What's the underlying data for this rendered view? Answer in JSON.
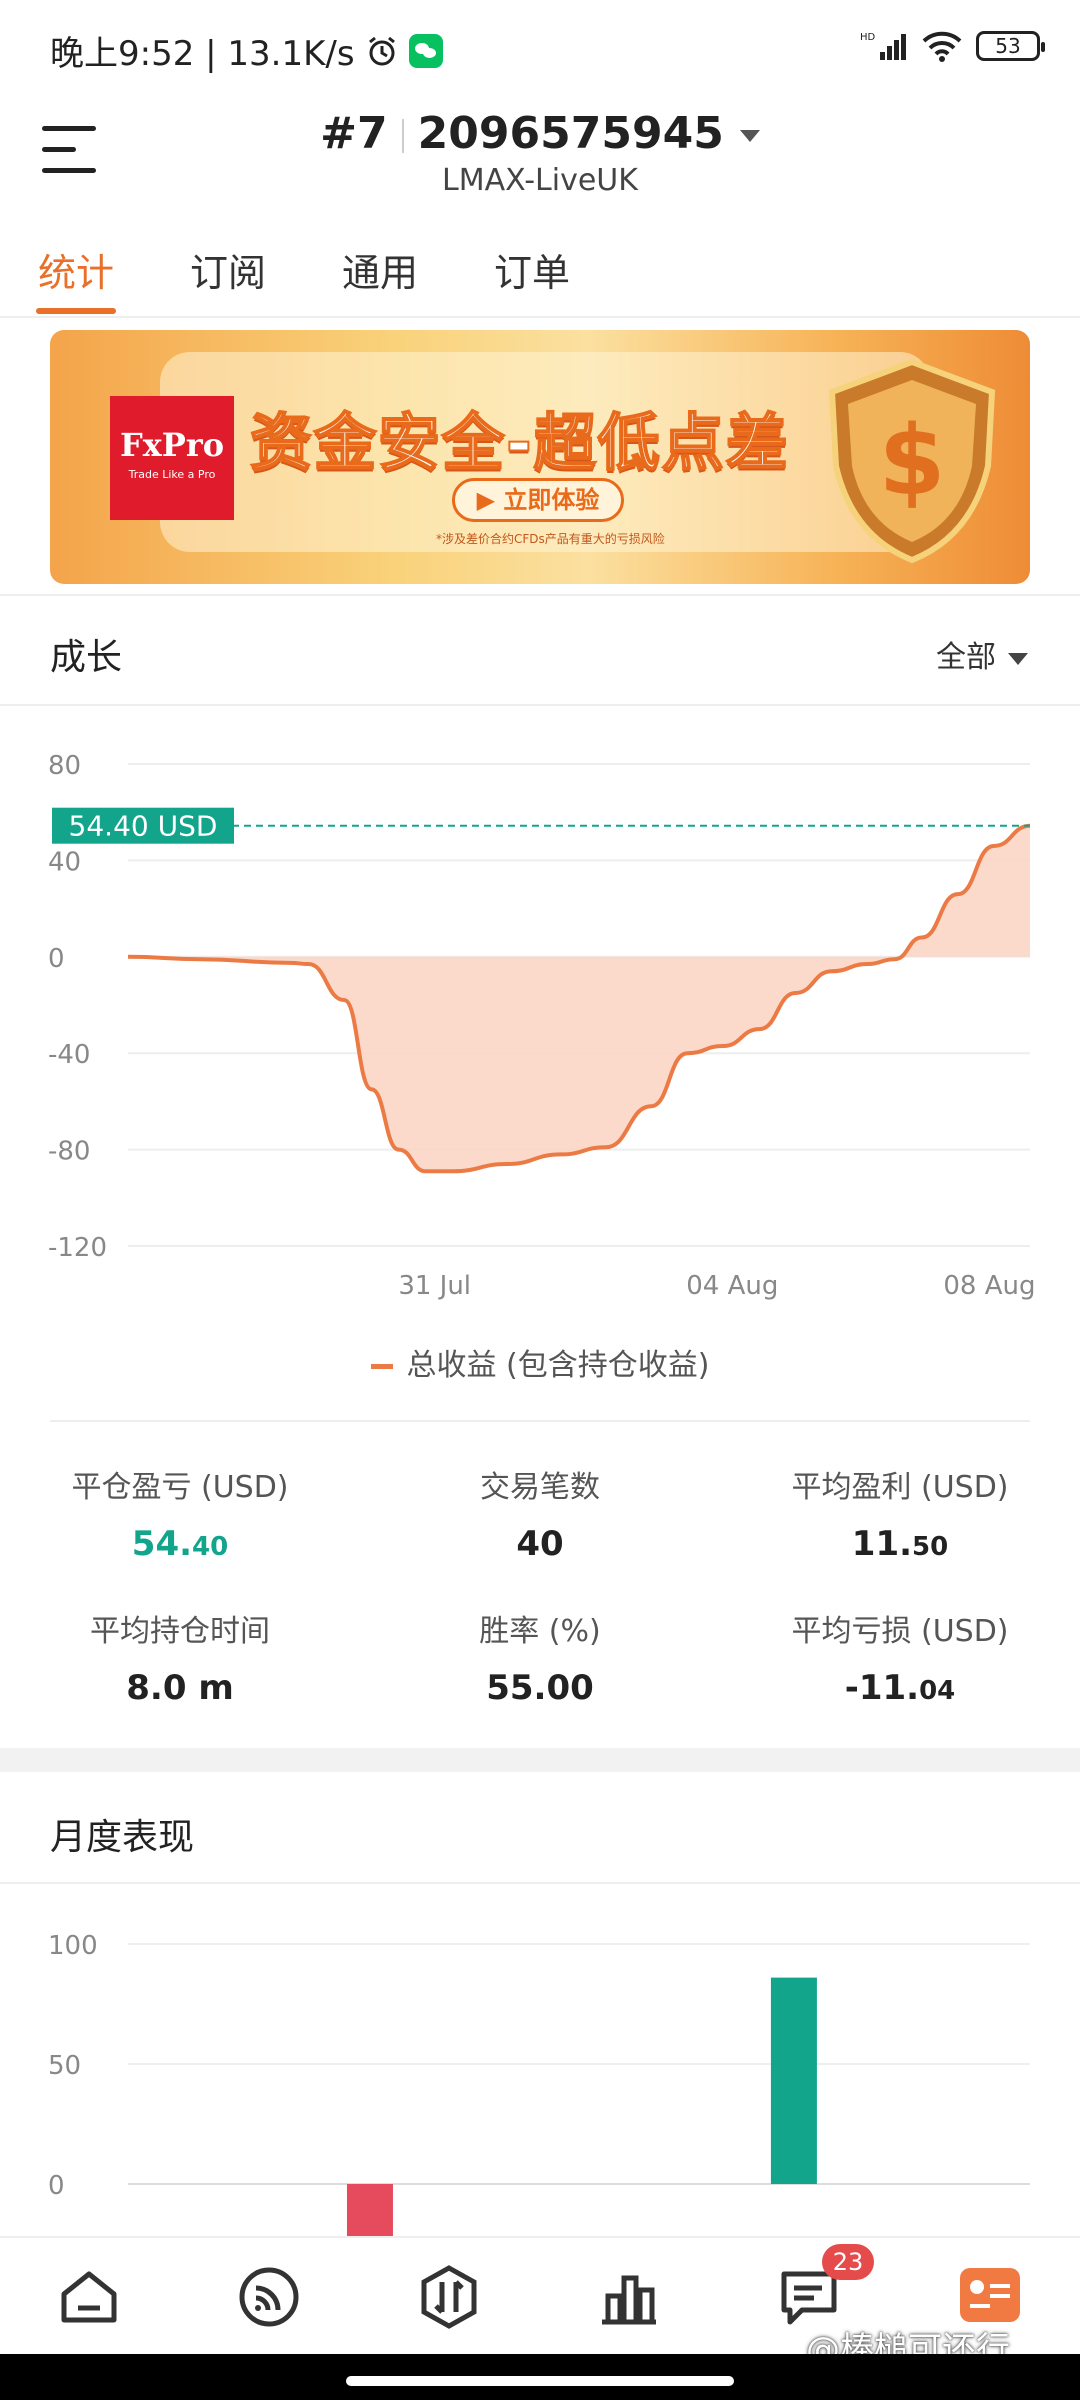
{
  "status": {
    "time": "晚上9:52 | 13.1K/s",
    "net": "HD",
    "battery": "53"
  },
  "header": {
    "account_number": "#7",
    "account_id": "2096575945",
    "server": "LMAX-LiveUK"
  },
  "tabs": [
    {
      "label": "统计",
      "active": true
    },
    {
      "label": "订阅",
      "active": false
    },
    {
      "label": "通用",
      "active": false
    },
    {
      "label": "订单",
      "active": false
    }
  ],
  "banner": {
    "brand": "FxPro",
    "brand_tagline": "Trade Like a Pro",
    "title": "资金安全-超低点差",
    "button": "立即体验",
    "note": "*涉及差价合约CFDs产品有重大的亏损风险"
  },
  "growth": {
    "title": "成长",
    "filter": "全部"
  },
  "chart_data": {
    "type": "area",
    "title": "",
    "xlabel": "",
    "ylabel": "",
    "ylim": [
      -120,
      80
    ],
    "yticks": [
      80,
      40,
      0,
      -40,
      -80,
      -120
    ],
    "xticks": [
      "31 Jul",
      "04 Aug",
      "08 Aug"
    ],
    "current_value_label": "54.40 USD",
    "current_value": 54.4,
    "series": [
      {
        "name": "总收益 (包含持仓收益)",
        "color": "#ec7a45",
        "x": [
          0,
          0.08,
          0.18,
          0.2,
          0.24,
          0.27,
          0.3,
          0.33,
          0.36,
          0.42,
          0.48,
          0.53,
          0.58,
          0.62,
          0.66,
          0.7,
          0.74,
          0.78,
          0.82,
          0.85,
          0.88,
          0.92,
          0.96,
          1.0
        ],
        "values": [
          0,
          -1,
          -2.5,
          -3,
          -18,
          -55,
          -80,
          -89,
          -89,
          -86,
          -82,
          -79,
          -62,
          -40,
          -37,
          -30,
          -15,
          -6,
          -3,
          -1,
          8,
          26,
          46,
          54.4
        ]
      }
    ]
  },
  "stats": [
    {
      "label": "平仓盈亏 (USD)",
      "value_main": "54.",
      "value_small": "40",
      "accent": "green"
    },
    {
      "label": "交易笔数",
      "value_main": "40",
      "value_small": ""
    },
    {
      "label": "平均盈利 (USD)",
      "value_main": "11.",
      "value_small": "50"
    },
    {
      "label": "平均持仓时间",
      "value_main": "8.0 m",
      "value_small": ""
    },
    {
      "label": "胜率 (%)",
      "value_main": "55.00",
      "value_small": ""
    },
    {
      "label": "平均亏损 (USD)",
      "value_main": "-11.",
      "value_small": "04"
    }
  ],
  "monthly": {
    "title": "月度表现",
    "chart_data": {
      "type": "bar",
      "ylim": [
        -20,
        100
      ],
      "yticks": [
        100,
        50,
        0
      ],
      "bars": [
        {
          "position": 0.25,
          "value": -25,
          "color": "#e54b5c"
        },
        {
          "position": 0.75,
          "value": 86,
          "color": "#13a58c"
        }
      ]
    }
  },
  "bottom_nav": {
    "items": [
      "home-icon",
      "feed-icon",
      "trade-icon",
      "chart-icon",
      "message-icon",
      "profile-icon"
    ],
    "message_badge": "23"
  },
  "watermark": "@棒槌可还行"
}
